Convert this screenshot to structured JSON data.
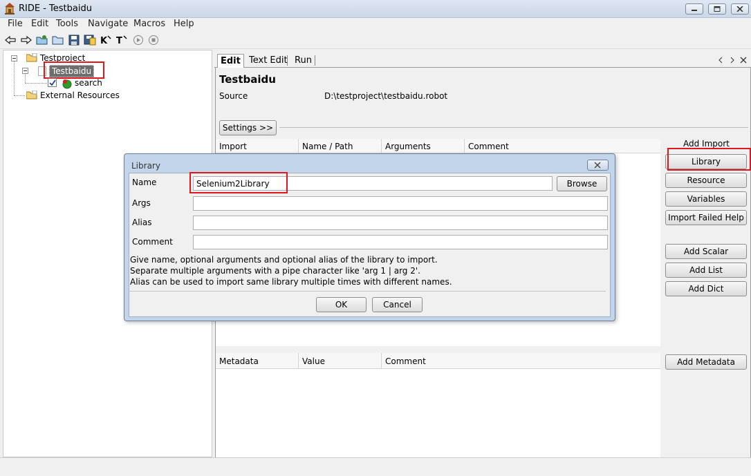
{
  "window": {
    "title": "RIDE - Testbaidu"
  },
  "menu": [
    "File",
    "Edit",
    "Tools",
    "Navigate",
    "Macros",
    "Help"
  ],
  "toolbar": {
    "icons": [
      "back-icon",
      "forward-icon",
      "open-directory-icon",
      "open-icon",
      "save-icon",
      "save-all-icon",
      "search-keywords-icon",
      "search-tests-icon",
      "run-icon",
      "stop-icon"
    ]
  },
  "tree": {
    "project": "Testproject",
    "suite": "Testbaidu",
    "test": "search",
    "resources": "External Resources"
  },
  "editor": {
    "tabs": [
      "Edit",
      "Text Edit",
      "Run"
    ],
    "heading": "Testbaidu",
    "source_label": "Source",
    "source_path": "D:\\testproject\\testbaidu.robot",
    "settings_button": "Settings >>",
    "import_headers": [
      "Import",
      "Name / Path",
      "Arguments",
      "Comment"
    ],
    "add_import_label": "Add Import",
    "import_buttons": [
      "Library",
      "Resource",
      "Variables",
      "Import Failed Help"
    ],
    "variable_buttons": [
      "Add Scalar",
      "Add List",
      "Add Dict"
    ],
    "metadata_headers": [
      "Metadata",
      "Value",
      "Comment"
    ],
    "add_metadata_button": "Add Metadata"
  },
  "dialog": {
    "title": "Library",
    "name_label": "Name",
    "name_value": "Selenium2Library",
    "browse_button": "Browse",
    "args_label": "Args",
    "alias_label": "Alias",
    "comment_label": "Comment",
    "help_lines": [
      "Give name, optional arguments and optional alias of the library to import.",
      "Separate multiple arguments with a pipe character like 'arg 1 | arg 2'.",
      "Alias can be used to import same library multiple times with different names."
    ],
    "ok_button": "OK",
    "cancel_button": "Cancel"
  }
}
